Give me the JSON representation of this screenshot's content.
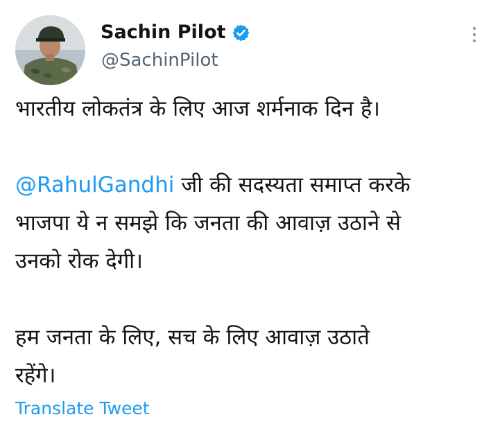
{
  "author": {
    "display_name": "Sachin Pilot",
    "handle": "@SachinPilot",
    "verified": true,
    "avatar_icon": "profile-photo-icon"
  },
  "menu": {
    "more_icon": "more-options-icon"
  },
  "tweet": {
    "line1": "भारतीय लोकतंत्र के लिए आज शर्मनाक दिन है।",
    "mention": "@RahulGandhi",
    "line2_rest": " जी की सदस्यता समाप्त करके",
    "line3": "भाजपा ये न समझे कि जनता की आवाज़ उठाने से",
    "line4": "उनको रोक देगी।",
    "line5": "हम जनता के लिए, सच के लिए आवाज़ उठाते",
    "line6": "रहेंगे।"
  },
  "translate_label": "Translate Tweet",
  "colors": {
    "accent": "#1d9bf0",
    "text": "#0f1419",
    "secondary": "#536471"
  }
}
